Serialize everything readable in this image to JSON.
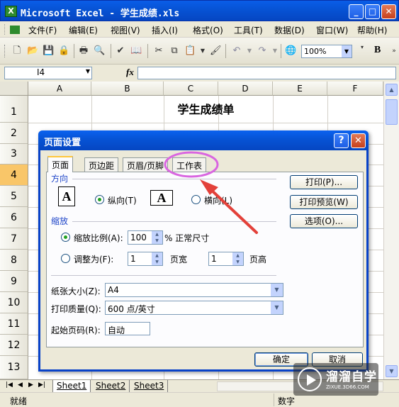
{
  "window": {
    "title": "Microsoft Excel - 学生成绩.xls",
    "min": "_",
    "max": "□",
    "close": "✕"
  },
  "menu": [
    {
      "label": "文件",
      "key": "(F)"
    },
    {
      "label": "编辑",
      "key": "(E)"
    },
    {
      "label": "视图",
      "key": "(V)"
    },
    {
      "label": "插入",
      "key": "(I)"
    },
    {
      "label": "格式",
      "key": "(O)"
    },
    {
      "label": "工具",
      "key": "(T)"
    },
    {
      "label": "数据",
      "key": "(D)"
    },
    {
      "label": "窗口",
      "key": "(W)"
    },
    {
      "label": "帮助",
      "key": "(H)"
    }
  ],
  "toolbar": {
    "zoom": "100%",
    "bold": "B",
    "icons": [
      "new-icon",
      "open-icon",
      "save-icon",
      "permission-icon",
      "print-icon",
      "print-preview-icon",
      "spelling-icon",
      "research-icon",
      "cut-icon",
      "copy-icon",
      "paste-icon",
      "format-painter-icon",
      "undo-icon",
      "redo-icon",
      "hyperlink-icon"
    ]
  },
  "formula": {
    "name_box": "I4",
    "fx": "fx"
  },
  "grid": {
    "columns": [
      "A",
      "B",
      "C",
      "D",
      "E",
      "F"
    ],
    "rows": [
      "1",
      "2",
      "3",
      "4",
      "5",
      "6",
      "7",
      "8",
      "9",
      "10",
      "11",
      "12",
      "13"
    ],
    "active_row": "4",
    "title": "学生成绩单"
  },
  "sheets": [
    "Sheet1",
    "Sheet2",
    "Sheet3"
  ],
  "status": {
    "ready": "就绪",
    "num": "数字"
  },
  "dialog": {
    "title": "页面设置",
    "help": "?",
    "close": "✕",
    "tabs": [
      "页面",
      "页边距",
      "页眉/页脚",
      "工作表"
    ],
    "active_tab": "页面",
    "orientation": {
      "section": "方向",
      "portrait": "纵向(T)",
      "landscape": "横向(L)",
      "icon_letter": "A",
      "selected": "portrait"
    },
    "scaling": {
      "section": "缩放",
      "adjust_label": "缩放比例(A):",
      "adjust_value": "100",
      "adjust_suffix": "% 正常尺寸",
      "fit_label": "调整为(F):",
      "fit_wide_value": "1",
      "fit_wide_label": "页宽",
      "fit_tall_value": "1",
      "fit_tall_label": "页高",
      "selected": "adjust"
    },
    "paper_size": {
      "label": "纸张大小(Z):",
      "value": "A4"
    },
    "print_quality": {
      "label": "打印质量(Q):",
      "value": "600 点/英寸"
    },
    "first_page": {
      "label": "起始页码(R):",
      "value": "自动"
    },
    "buttons": {
      "print": "打印(P)...",
      "preview": "打印预览(W)",
      "options": "选项(O)...",
      "ok": "确定",
      "cancel": "取消"
    }
  },
  "annotation": {
    "ellipse_color": "#d966e0",
    "arrow_color": "#e3413a"
  },
  "watermark": {
    "brand": "溜溜自学",
    "site": "ZIXUE.3D66.COM"
  }
}
